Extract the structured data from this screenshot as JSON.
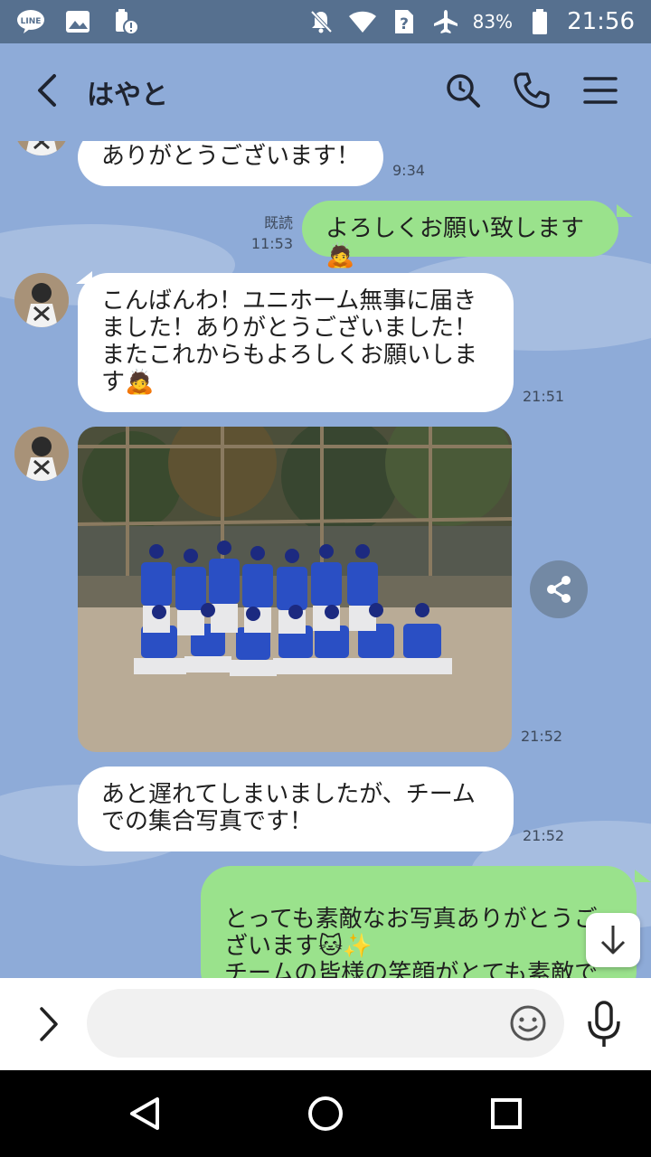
{
  "status_bar": {
    "battery": "83%",
    "time": "21:56",
    "left_icons": [
      "line-notification-icon",
      "gallery-icon",
      "battery-saver-icon"
    ],
    "right_icons": [
      "notifications-muted-icon",
      "wifi-icon",
      "no-sim-icon",
      "airplane-mode-icon",
      "battery-icon"
    ]
  },
  "header": {
    "title": "はやと",
    "buttons": [
      "back-icon",
      "search-icon",
      "call-icon",
      "menu-icon"
    ]
  },
  "messages": [
    {
      "side": "in",
      "text": "ありがとうございます！",
      "time": "9:34"
    },
    {
      "side": "out",
      "text": "よろしくお願い致します🙇",
      "read": "既読",
      "time": "11:53"
    },
    {
      "side": "in",
      "text": "こんばんわ！ユニホーム無事に届きました！ありがとうございました！またこれからもよろしくお願いします🙇",
      "time": "21:51"
    },
    {
      "side": "in",
      "type": "photo",
      "time": "21:52"
    },
    {
      "side": "in",
      "text": "あと遅れてしまいましたが、チームでの集合写真です！",
      "time": "21:52"
    },
    {
      "side": "out",
      "text": "とっても素敵なお写真ありがとうございます🐱✨\nチームの皆様の笑顔がとても素敵です✨"
    }
  ],
  "input_bar": {
    "placeholder": "",
    "icons": [
      "expand-icon",
      "emoji-icon",
      "microphone-icon"
    ]
  },
  "colors": {
    "chat_background": "#8eabd8",
    "outgoing_bubble": "#9ae28c",
    "incoming_bubble": "#ffffff",
    "status_bar": "#56708f"
  }
}
